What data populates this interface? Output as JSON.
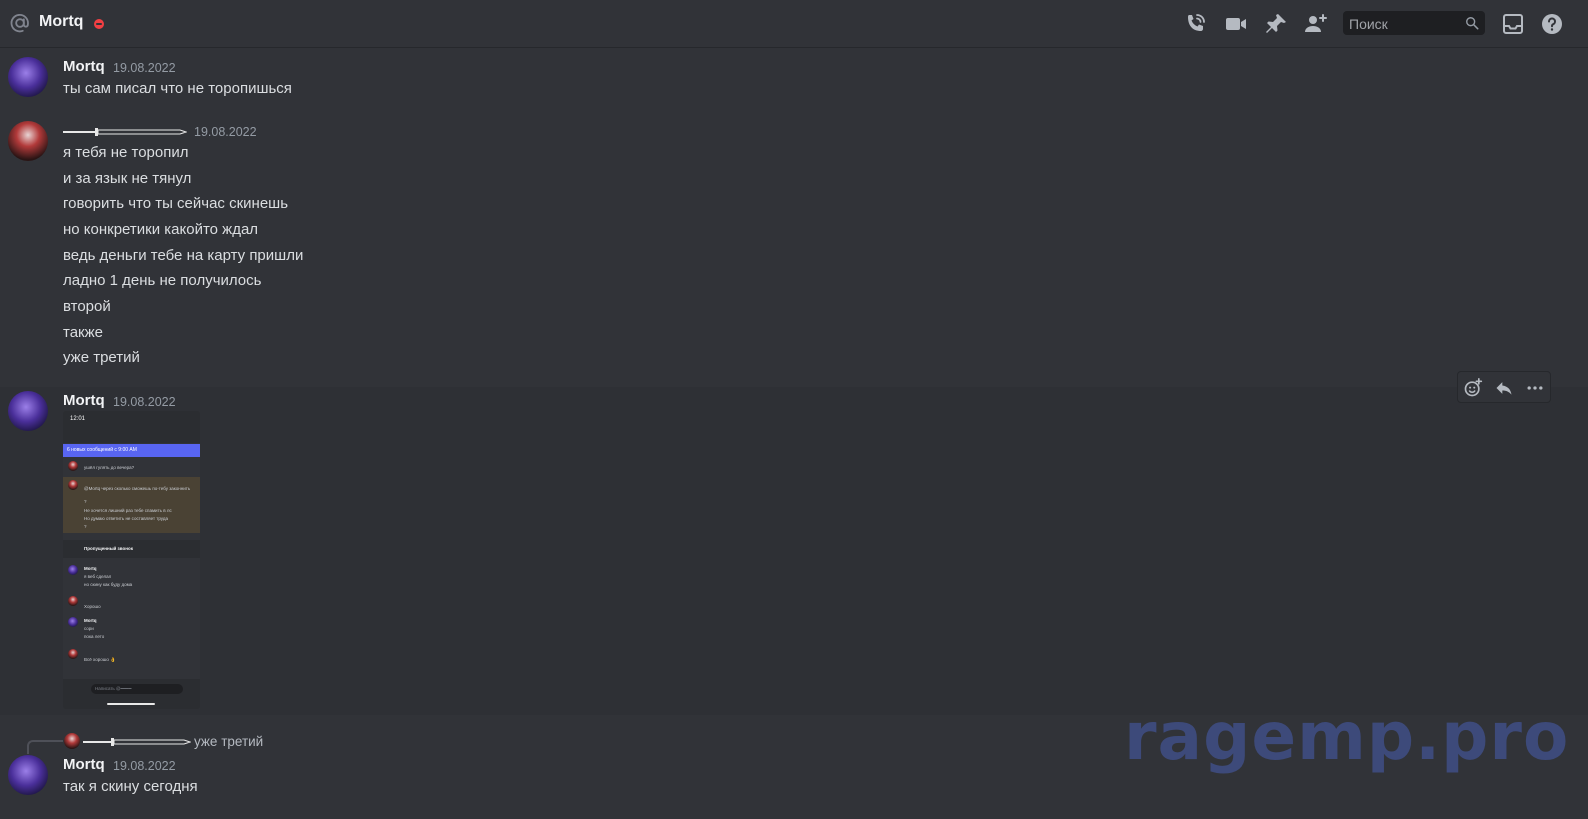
{
  "header": {
    "title": "Mortq",
    "status": "dnd",
    "search_placeholder": "Поиск",
    "icons": [
      "at-icon",
      "start-voice-call-icon",
      "start-video-call-icon",
      "pinned-messages-icon",
      "add-friends-to-dm-icon",
      "search-icon",
      "inbox-icon",
      "help-icon"
    ]
  },
  "messages": [
    {
      "author": "Mortq",
      "timestamp": "19.08.2022",
      "lines": [
        "ты сам писал что не торопишься"
      ]
    },
    {
      "author_icon": "sword-name-icon",
      "timestamp": "19.08.2022",
      "lines": [
        "я тебя не торопил",
        "и за язык не тянул",
        "говорить что ты сейчас скинешь",
        "но конкретики какойто ждал",
        "ведь деньги тебе на карту пришли",
        "ладно 1 день не получилось",
        "второй",
        "также",
        "уже третий"
      ]
    },
    {
      "author": "Mortq",
      "timestamp": "19.08.2022",
      "attachment": {
        "status_time": "12:01",
        "banner": "6 новых сообщений с 9:00 AM",
        "lines": [
          "ушёл гулять до вечера?",
          "@Mortq через сколько сможешь по-тебу законнить",
          "?",
          "Не хочется лишний раз тебе спамить в лс",
          "Но думаю ответить не составляет труда",
          "?",
          "Пропущенный звонок",
          "Mortq",
          "я веб сделал",
          "но скину как буду дома",
          "Хорошо",
          "Mortq",
          "сори",
          "пока лето",
          "Всё хорошо 👌"
        ],
        "input_placeholder": "Написать @━━━━"
      },
      "actions": [
        "add-reaction-icon",
        "reply-icon",
        "more-icon"
      ]
    },
    {
      "reply_to_text": "уже третий",
      "author": "Mortq",
      "timestamp": "19.08.2022",
      "lines": [
        "так я скину сегодня"
      ]
    }
  ],
  "watermark": "ragemp.pro"
}
